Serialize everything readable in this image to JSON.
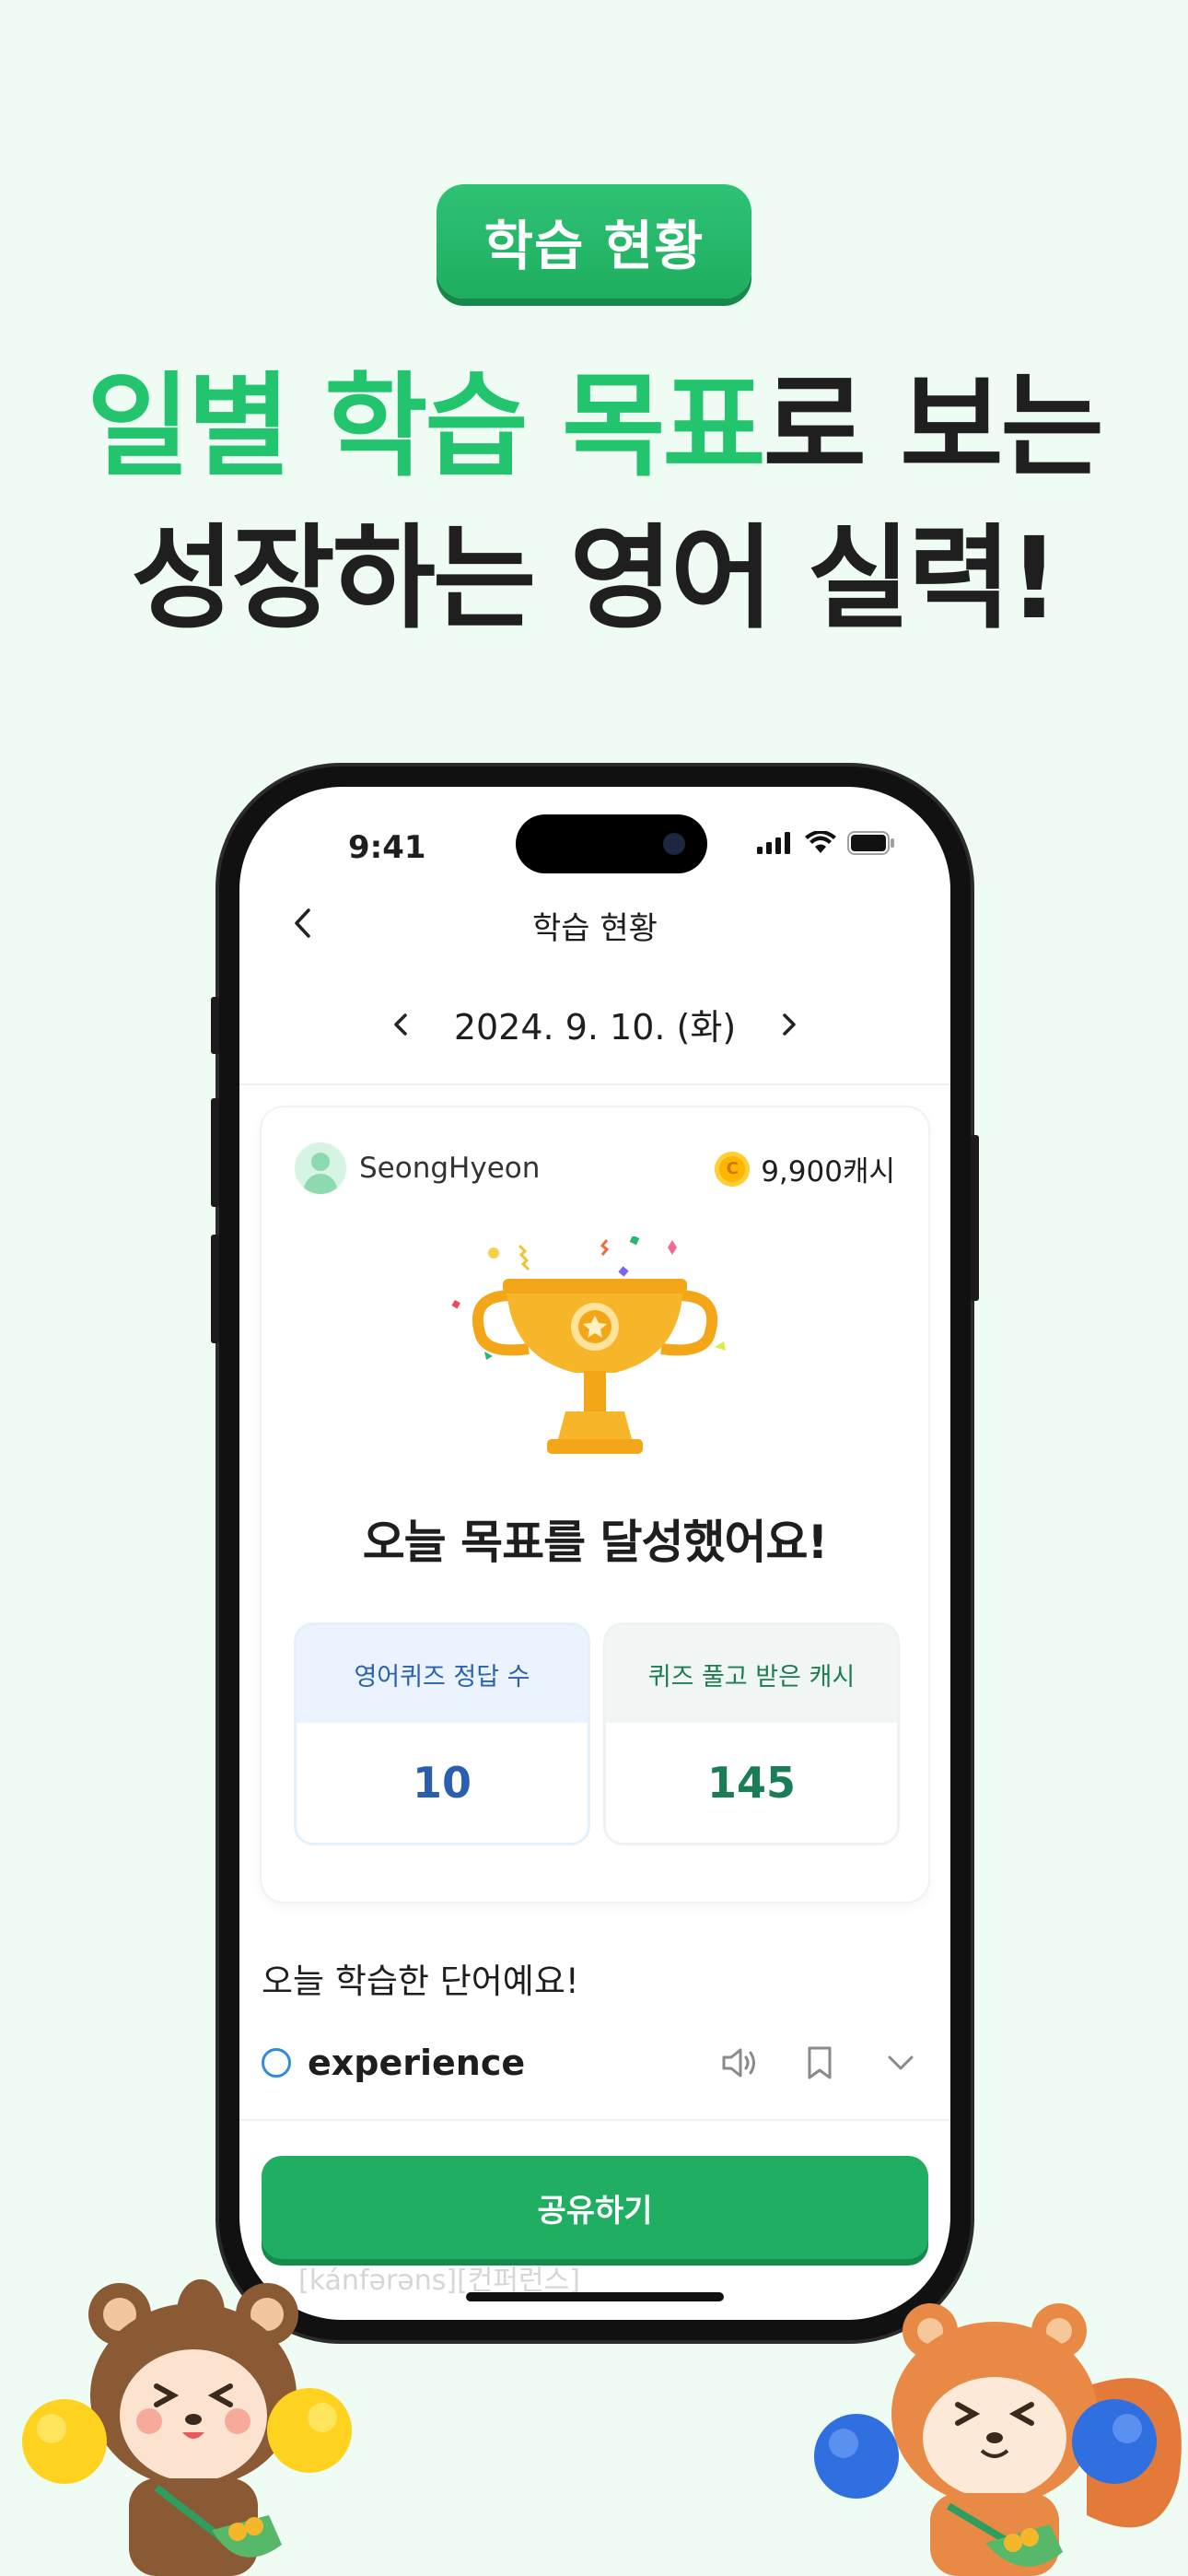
{
  "promo": {
    "badge": "학습 현황",
    "headline_line1_highlight": "일별 학습 목표",
    "headline_line1_rest": "로 보는",
    "headline_line2": "성장하는 영어 실력!"
  },
  "status_bar": {
    "time": "9:41"
  },
  "nav": {
    "title": "학습 현황"
  },
  "date": {
    "label": "2024. 9. 10. (화)"
  },
  "card": {
    "username": "SeongHyeon",
    "cash": "9,900캐시",
    "goal_message": "오늘 목표를 달성했어요!",
    "stats": [
      {
        "label": "영어퀴즈 정답 수",
        "value": "10"
      },
      {
        "label": "퀴즈 풀고 받은 캐시",
        "value": "145"
      }
    ]
  },
  "words": {
    "title": "오늘 학습한 단어예요!",
    "items": [
      {
        "word": "experience"
      }
    ],
    "phonetic": "[kánfərəns][컨퍼런스]"
  },
  "share_button": "공유하기",
  "colors": {
    "brand_green": "#1fae62",
    "headline_green": "#22c46e",
    "background": "#eefcf3",
    "stat_blue": "#2a5fb0",
    "stat_green": "#1b7d55"
  },
  "icons": [
    "back-chevron-icon",
    "chevron-left-icon",
    "chevron-right-icon",
    "signal-icon",
    "wifi-icon",
    "battery-icon",
    "coin-icon",
    "trophy-icon",
    "speaker-icon",
    "bookmark-icon",
    "chevron-down-icon"
  ]
}
